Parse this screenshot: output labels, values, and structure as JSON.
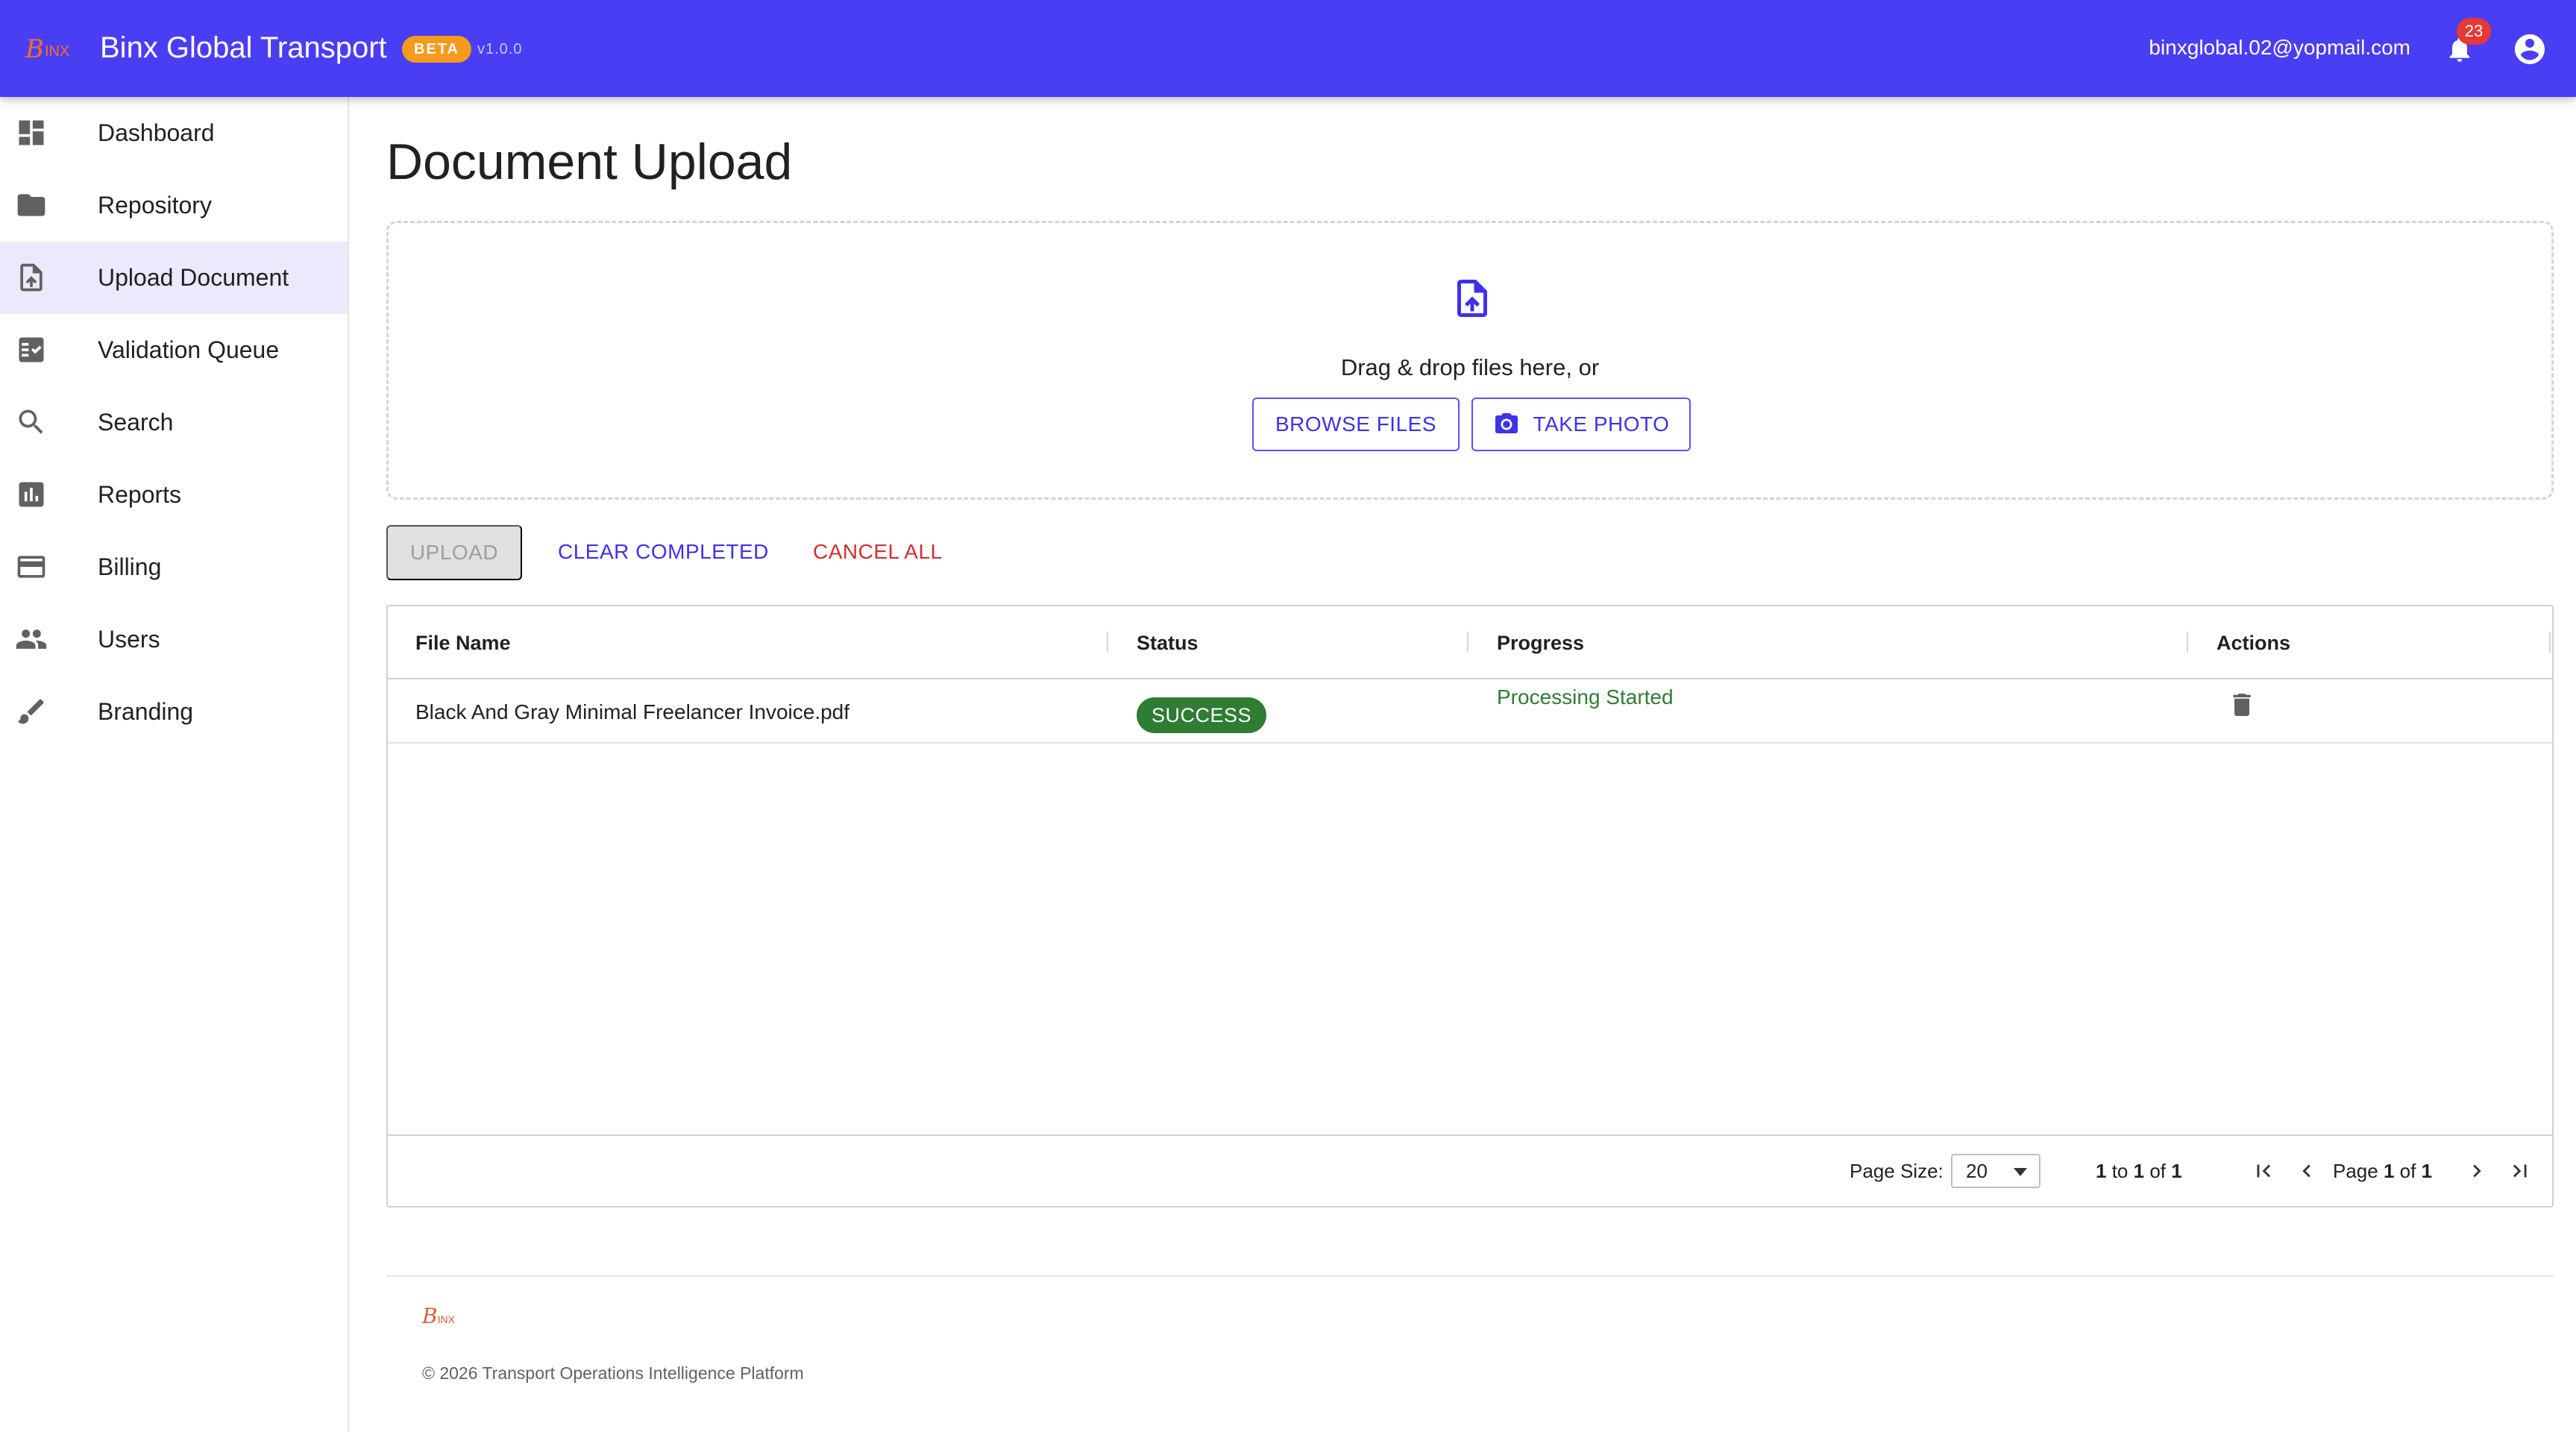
{
  "header": {
    "logo_text": "BINX",
    "app_title": "Binx Global Transport",
    "beta_label": "BETA",
    "version": "v1.0.0",
    "user_email": "binxglobal.02@yopmail.com",
    "notification_count": "23",
    "bar_color": "#4a3ef5"
  },
  "sidebar": {
    "items": [
      {
        "label": "Dashboard",
        "icon": "dashboard-icon"
      },
      {
        "label": "Repository",
        "icon": "folder-icon"
      },
      {
        "label": "Upload Document",
        "icon": "upload-file-icon",
        "active": true
      },
      {
        "label": "Validation Queue",
        "icon": "checklist-icon"
      },
      {
        "label": "Search",
        "icon": "search-icon"
      },
      {
        "label": "Reports",
        "icon": "bar-chart-icon"
      },
      {
        "label": "Billing",
        "icon": "credit-card-icon"
      },
      {
        "label": "Users",
        "icon": "people-icon"
      },
      {
        "label": "Branding",
        "icon": "brush-icon"
      }
    ]
  },
  "main": {
    "title": "Document Upload",
    "dropzone": {
      "text": "Drag & drop files here, or",
      "browse_label": "BROWSE FILES",
      "photo_label": "TAKE PHOTO"
    },
    "actions": {
      "upload_label": "UPLOAD",
      "clear_label": "CLEAR COMPLETED",
      "cancel_label": "CANCEL ALL"
    },
    "table": {
      "columns": [
        "File Name",
        "Status",
        "Progress",
        "Actions"
      ],
      "rows": [
        {
          "file_name": "Black And Gray Minimal Freelancer Invoice.pdf",
          "status": "SUCCESS",
          "progress": "Processing Started"
        }
      ],
      "pagination": {
        "page_size_label": "Page Size:",
        "page_size": "20",
        "range_from": "1",
        "range_to_word": "to",
        "range_to": "1",
        "of_word": "of",
        "total": "1",
        "page_word": "Page",
        "page_current": "1",
        "page_total": "1"
      }
    }
  },
  "footer": {
    "logo_text": "BINX",
    "copyright": "© 2026 Transport Operations Intelligence Platform"
  }
}
